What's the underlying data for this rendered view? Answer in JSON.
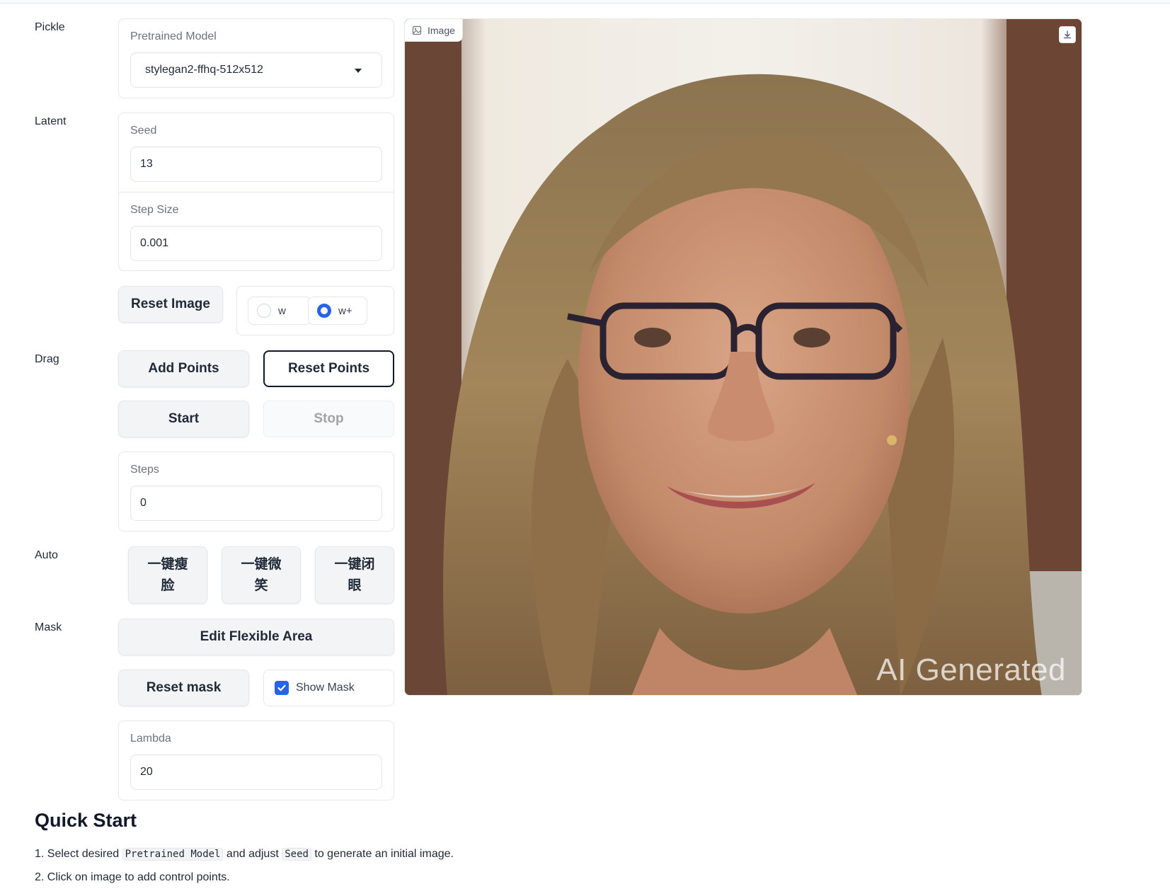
{
  "sections": {
    "pickle": "Pickle",
    "latent": "Latent",
    "drag": "Drag",
    "auto": "Auto",
    "mask": "Mask"
  },
  "pretrained_model": {
    "label": "Pretrained Model",
    "value": "stylegan2-ffhq-512x512"
  },
  "seed": {
    "label": "Seed",
    "value": "13"
  },
  "step_size": {
    "label": "Step Size",
    "value": "0.001"
  },
  "reset_image_label": "Reset Image",
  "latent_space": {
    "options": [
      "w",
      "w+"
    ],
    "selected": "w+"
  },
  "drag": {
    "add_points": "Add Points",
    "reset_points": "Reset Points",
    "start": "Start",
    "stop": "Stop",
    "steps_label": "Steps",
    "steps_value": "0"
  },
  "auto": {
    "buttons": [
      {
        "line1": "一键瘦",
        "line2": "脸"
      },
      {
        "line1": "一键微",
        "line2": "笑"
      },
      {
        "line1": "一键闭",
        "line2": "眼"
      }
    ]
  },
  "mask": {
    "edit_flexible_area": "Edit Flexible Area",
    "reset_mask": "Reset mask",
    "show_mask_label": "Show Mask",
    "show_mask_checked": true,
    "lambda_label": "Lambda",
    "lambda_value": "20"
  },
  "image": {
    "tag": "Image",
    "watermark": "AI Generated"
  },
  "quick_start": {
    "title": "Quick Start",
    "line1": {
      "pre": "1. Select desired ",
      "code1": "Pretrained Model",
      "mid": " and adjust ",
      "code2": "Seed",
      "post": " to generate an initial image."
    },
    "line2": "2. Click on image to add control points."
  },
  "colors": {
    "accent": "#2563eb",
    "border": "#e5e7eb",
    "button_bg": "#f3f4f6"
  }
}
